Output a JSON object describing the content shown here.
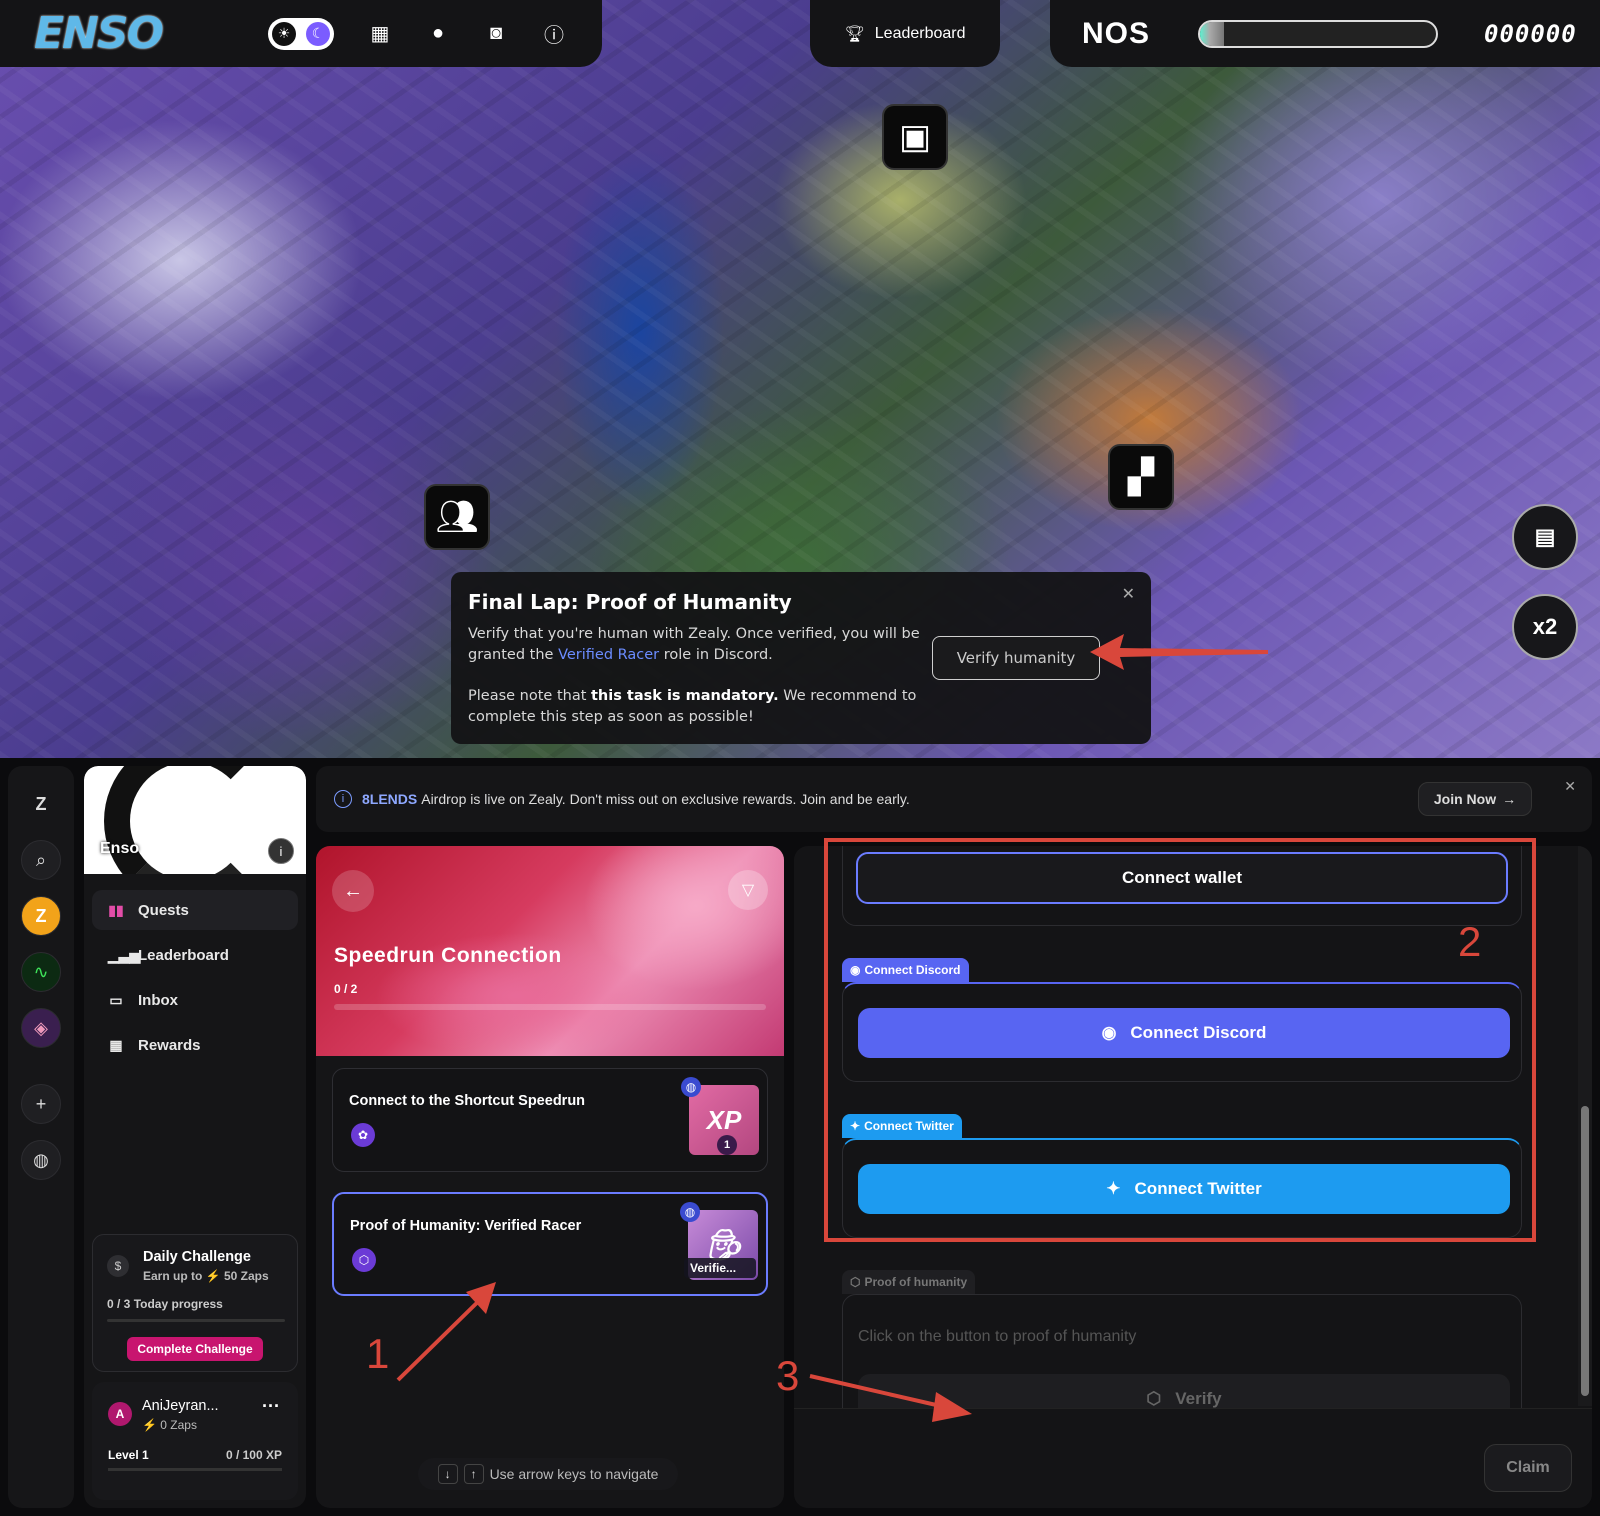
{
  "game": {
    "logo": "ENSO",
    "leaderboard_label": "Leaderboard",
    "nos_label": "NOS",
    "score": "000000",
    "nos_fuel": 0.1,
    "multiplier": "x2",
    "popup": {
      "title": "Final Lap: Proof of Humanity",
      "p1_a": "Verify that you're human with Zealy. Once verified, you will be granted the ",
      "p1_link": "Verified Racer",
      "p1_b": " role in Discord.",
      "p2_a": "Please note that ",
      "p2_bold": "this task is mandatory.",
      "p2_b": " We recommend to complete this step as soon as possible!",
      "button": "Verify humanity"
    }
  },
  "zealy": {
    "community_name": "Enso",
    "nav": [
      {
        "label": "Quests",
        "icon": "quests-icon"
      },
      {
        "label": "Leaderboard",
        "icon": "bar-chart-icon"
      },
      {
        "label": "Inbox",
        "icon": "inbox-icon"
      },
      {
        "label": "Rewards",
        "icon": "gift-icon"
      }
    ],
    "daily": {
      "title": "Daily Challenge",
      "sub_a": "Earn up to",
      "sub_b": "50 Zaps",
      "progress_count": "0 / 3",
      "progress_label": "Today progress",
      "button": "Complete Challenge"
    },
    "user": {
      "initial": "A",
      "name": "AniJeyran...",
      "zaps": "0 Zaps",
      "level": "Level 1",
      "xp": "0 / 100 XP"
    },
    "announcement": {
      "brand": "8LENDS",
      "text": "Airdrop is live on Zealy. Don't miss out on exclusive rewards. Join and be early.",
      "button": "Join Now"
    },
    "module": {
      "title": "Speedrun Connection",
      "progress": "0 / 2"
    },
    "quests": [
      {
        "title": "Connect to the Shortcut Speedrun",
        "thumb": "XP",
        "badge": "1"
      },
      {
        "title": "Proof of Humanity: Verified Racer",
        "thumb_label": "Verifie..."
      }
    ],
    "hint": "Use arrow keys to navigate",
    "detail": {
      "wallet_button": "Connect wallet",
      "discord_tab": "Connect Discord",
      "discord_button": "Connect Discord",
      "twitter_tab": "Connect Twitter",
      "twitter_button": "Connect Twitter",
      "poh_tab": "Proof of humanity",
      "poh_text": "Click on the button to proof of humanity",
      "verify_button": "Verify",
      "claim_button": "Claim"
    }
  },
  "annotations": {
    "one": "1",
    "two": "2",
    "three": "3",
    "color": "#d9473b"
  },
  "colors": {
    "discord": "#5865f2",
    "twitter": "#1d9bf0",
    "accent": "#6b7cff",
    "challenge": "#c8156f"
  }
}
